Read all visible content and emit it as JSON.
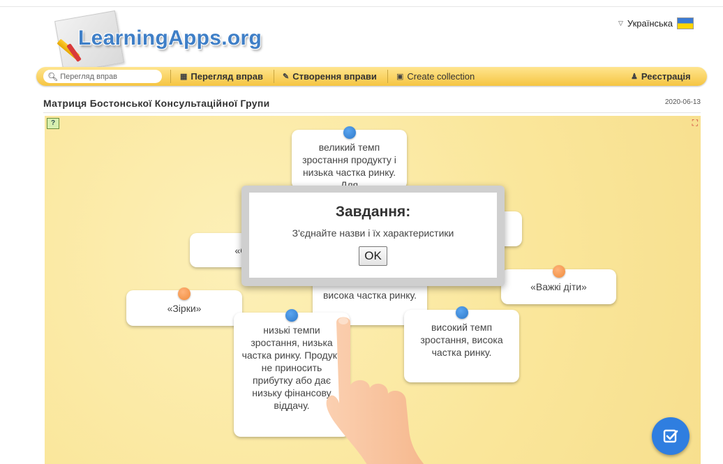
{
  "header": {
    "logo_text": "LearningApps.org",
    "language": "Українська"
  },
  "nav": {
    "search_placeholder": "Перегляд вправ",
    "items": [
      {
        "label": "Перегляд вправ",
        "icon": "grid-icon"
      },
      {
        "label": "Створення вправи",
        "icon": "pencil-icon"
      },
      {
        "label": "Create collection",
        "icon": "collection-icon"
      }
    ],
    "register_label": "Реєстрація"
  },
  "page": {
    "title": "Матриця Бостонської Консультаційної Групи",
    "date": "2020-06-13"
  },
  "cards": [
    {
      "text": "великий темп зростання продукту і низька частка ринку. Для",
      "dot": "blue"
    },
    {
      "text": "«Со",
      "dot": "none"
    },
    {
      "text": "«Зірки»",
      "dot": "orange"
    },
    {
      "text": "висока частка ринку.",
      "dot": "none"
    },
    {
      "text": "«Важкі діти»",
      "dot": "orange"
    },
    {
      "text": "низькі темпи зростання, низька частка ринку. Продукт не приносить прибутку або дає низьку фінансову віддачу.",
      "dot": "blue"
    },
    {
      "text": "високий темп зростання, висока частка ринку.",
      "dot": "blue"
    }
  ],
  "modal": {
    "title": "Завдання:",
    "text": "З'єднайте назви і їх характеристики",
    "ok_label": "OK"
  },
  "colors": {
    "navbar": "#f5c542",
    "app_background": "#fae69a",
    "accent_blue": "#2f7ee0",
    "dot_orange": "#f08b3c"
  }
}
